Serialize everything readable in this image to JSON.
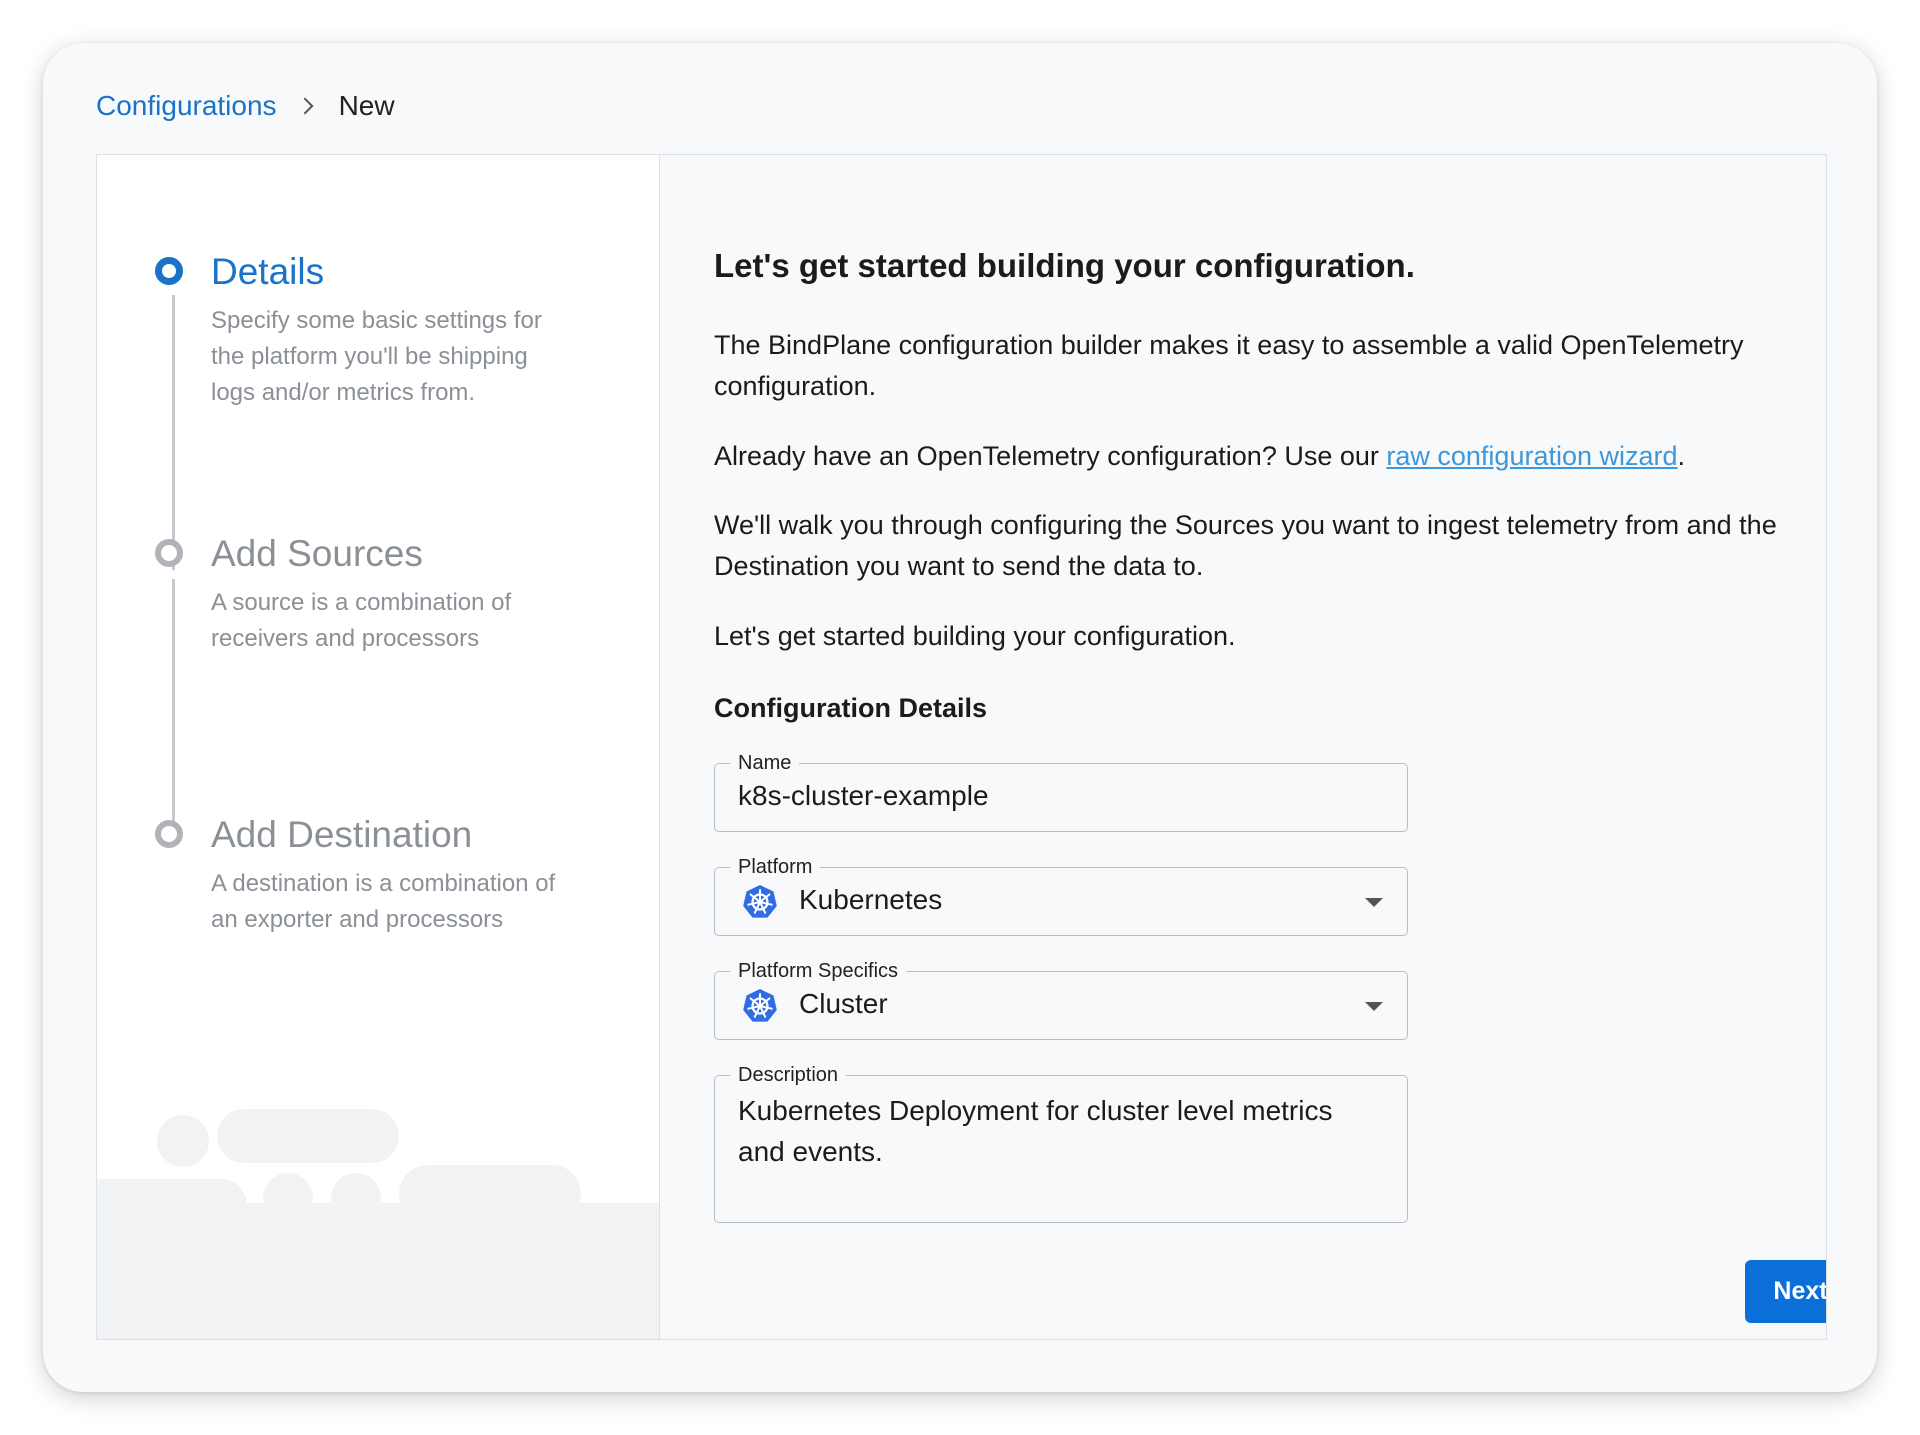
{
  "breadcrumb": {
    "parent": "Configurations",
    "current": "New"
  },
  "steps": [
    {
      "title": "Details",
      "description": "Specify some basic settings for the platform you'll be shipping logs and/or metrics from.",
      "state": "active"
    },
    {
      "title": "Add Sources",
      "description": "A source is a combination of receivers and processors",
      "state": "pending"
    },
    {
      "title": "Add Destination",
      "description": "A destination is a combination of an exporter and processors",
      "state": "pending"
    }
  ],
  "main": {
    "heading": "Let's get started building your configuration.",
    "intro": "The BindPlane configuration builder makes it easy to assemble a valid OpenTelemetry configuration.",
    "raw_prefix": "Already have an OpenTelemetry configuration? Use our ",
    "raw_link": "raw configuration wizard",
    "raw_suffix": ".",
    "walkthrough": "We'll walk you through configuring the Sources you want to ingest telemetry from and the Destination you want to send the data to.",
    "closing": "Let's get started building your configuration.",
    "section_title": "Configuration Details"
  },
  "form": {
    "name": {
      "label": "Name",
      "value": "k8s-cluster-example"
    },
    "platform": {
      "label": "Platform",
      "value": "Kubernetes",
      "icon": "kubernetes-icon"
    },
    "platform_specifics": {
      "label": "Platform Specifics",
      "value": "Cluster",
      "icon": "kubernetes-icon"
    },
    "description": {
      "label": "Description",
      "value": "Kubernetes Deployment for cluster level metrics and events."
    }
  },
  "actions": {
    "next": "Next"
  },
  "colors": {
    "accent": "#1a73c8",
    "button": "#0b6fd9",
    "link": "#3d97d8",
    "kubernetes": "#326ce5"
  }
}
